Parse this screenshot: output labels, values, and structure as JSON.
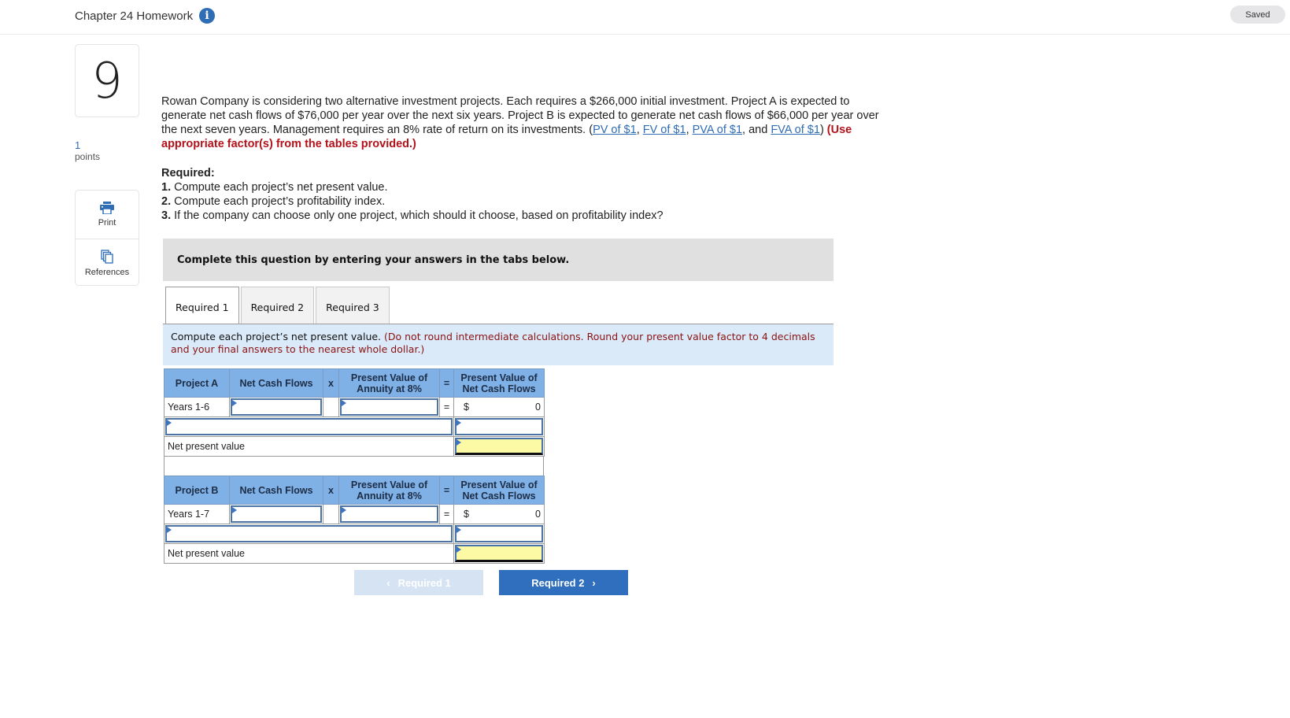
{
  "header": {
    "title": "Chapter 24 Homework",
    "info_icon": "info-icon",
    "saved": "Saved"
  },
  "question": {
    "number": "9",
    "points_value": "1",
    "points_label": "points"
  },
  "tools": [
    {
      "label": "Print",
      "icon": "printer-icon"
    },
    {
      "label": "References",
      "icon": "references-icon"
    }
  ],
  "problem": {
    "text_1": "Rowan Company is considering two alternative investment projects. Each requires a $266,000 initial investment. Project A is expected to generate net cash flows of $76,000 per year over the next six years. Project B is expected to generate net cash flows of $66,000 per year over the next seven years. Management requires an 8% rate of return on its investments. (",
    "links": [
      "PV of $1",
      "FV of $1",
      "PVA of $1",
      "FVA of $1"
    ],
    "sep_1": ", ",
    "sep_2": ", ",
    "sep_3": ", and ",
    "close_paren": ") ",
    "emphasis": "(Use appropriate factor(s) from the tables provided.)"
  },
  "required": {
    "heading": "Required:",
    "items": [
      {
        "num": "1.",
        "text": " Compute each project’s net present value."
      },
      {
        "num": "2.",
        "text": " Compute each project’s profitability index."
      },
      {
        "num": "3.",
        "text": " If the company can choose only one project, which should it choose, based on profitability index?"
      }
    ]
  },
  "instruction": "Complete this question by entering your answers in the tabs below.",
  "tabs": [
    {
      "label": "Required 1",
      "active": true
    },
    {
      "label": "Required 2",
      "active": false
    },
    {
      "label": "Required 3",
      "active": false
    }
  ],
  "directions": {
    "main": "Compute each project’s net present value. ",
    "note": "(Do not round intermediate calculations. Round your present value factor to 4 decimals and your final answers to the nearest whole dollar.)"
  },
  "table_headers": {
    "net_cash_flows": "Net Cash Flows",
    "times": "x",
    "pv_annuity": "Present Value of Annuity at 8%",
    "equals": "=",
    "pv_ncf": "Present Value of Net Cash Flows"
  },
  "projects": [
    {
      "name": "Project A",
      "row_label": "Years 1-6",
      "net_cash_flows": "",
      "pv_factor": "",
      "equals": "=",
      "currency": "$",
      "pv_value": "0",
      "extra_label": "",
      "extra_value": "",
      "npv_label": "Net present value",
      "npv_value": ""
    },
    {
      "name": "Project B",
      "row_label": "Years 1-7",
      "net_cash_flows": "",
      "pv_factor": "",
      "equals": "=",
      "currency": "$",
      "pv_value": "0",
      "extra_label": "",
      "extra_value": "",
      "npv_label": "Net present value",
      "npv_value": ""
    }
  ],
  "nav": {
    "prev_label": "Required 1",
    "next_label": "Required 2"
  }
}
